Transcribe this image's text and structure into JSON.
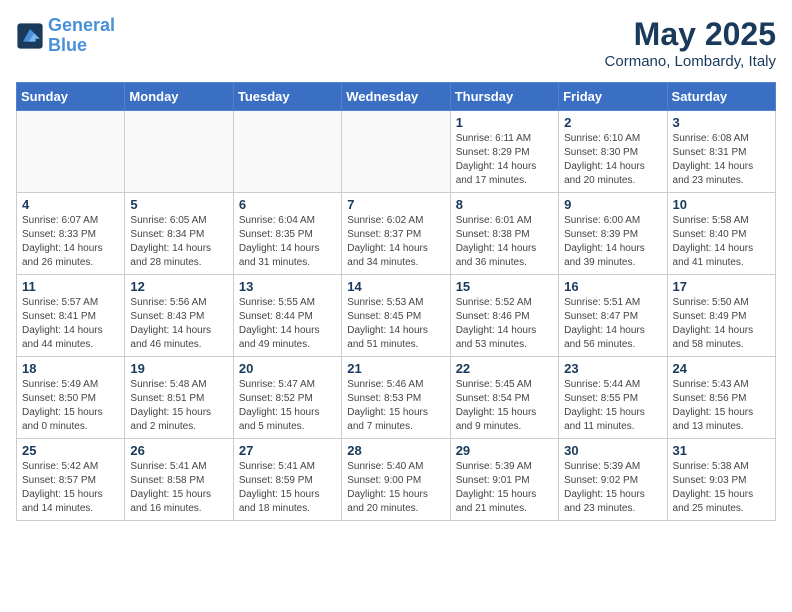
{
  "header": {
    "logo_line1": "General",
    "logo_line2": "Blue",
    "month": "May 2025",
    "location": "Cormano, Lombardy, Italy"
  },
  "weekdays": [
    "Sunday",
    "Monday",
    "Tuesday",
    "Wednesday",
    "Thursday",
    "Friday",
    "Saturday"
  ],
  "weeks": [
    [
      {
        "day": "",
        "info": ""
      },
      {
        "day": "",
        "info": ""
      },
      {
        "day": "",
        "info": ""
      },
      {
        "day": "",
        "info": ""
      },
      {
        "day": "1",
        "info": "Sunrise: 6:11 AM\nSunset: 8:29 PM\nDaylight: 14 hours\nand 17 minutes."
      },
      {
        "day": "2",
        "info": "Sunrise: 6:10 AM\nSunset: 8:30 PM\nDaylight: 14 hours\nand 20 minutes."
      },
      {
        "day": "3",
        "info": "Sunrise: 6:08 AM\nSunset: 8:31 PM\nDaylight: 14 hours\nand 23 minutes."
      }
    ],
    [
      {
        "day": "4",
        "info": "Sunrise: 6:07 AM\nSunset: 8:33 PM\nDaylight: 14 hours\nand 26 minutes."
      },
      {
        "day": "5",
        "info": "Sunrise: 6:05 AM\nSunset: 8:34 PM\nDaylight: 14 hours\nand 28 minutes."
      },
      {
        "day": "6",
        "info": "Sunrise: 6:04 AM\nSunset: 8:35 PM\nDaylight: 14 hours\nand 31 minutes."
      },
      {
        "day": "7",
        "info": "Sunrise: 6:02 AM\nSunset: 8:37 PM\nDaylight: 14 hours\nand 34 minutes."
      },
      {
        "day": "8",
        "info": "Sunrise: 6:01 AM\nSunset: 8:38 PM\nDaylight: 14 hours\nand 36 minutes."
      },
      {
        "day": "9",
        "info": "Sunrise: 6:00 AM\nSunset: 8:39 PM\nDaylight: 14 hours\nand 39 minutes."
      },
      {
        "day": "10",
        "info": "Sunrise: 5:58 AM\nSunset: 8:40 PM\nDaylight: 14 hours\nand 41 minutes."
      }
    ],
    [
      {
        "day": "11",
        "info": "Sunrise: 5:57 AM\nSunset: 8:41 PM\nDaylight: 14 hours\nand 44 minutes."
      },
      {
        "day": "12",
        "info": "Sunrise: 5:56 AM\nSunset: 8:43 PM\nDaylight: 14 hours\nand 46 minutes."
      },
      {
        "day": "13",
        "info": "Sunrise: 5:55 AM\nSunset: 8:44 PM\nDaylight: 14 hours\nand 49 minutes."
      },
      {
        "day": "14",
        "info": "Sunrise: 5:53 AM\nSunset: 8:45 PM\nDaylight: 14 hours\nand 51 minutes."
      },
      {
        "day": "15",
        "info": "Sunrise: 5:52 AM\nSunset: 8:46 PM\nDaylight: 14 hours\nand 53 minutes."
      },
      {
        "day": "16",
        "info": "Sunrise: 5:51 AM\nSunset: 8:47 PM\nDaylight: 14 hours\nand 56 minutes."
      },
      {
        "day": "17",
        "info": "Sunrise: 5:50 AM\nSunset: 8:49 PM\nDaylight: 14 hours\nand 58 minutes."
      }
    ],
    [
      {
        "day": "18",
        "info": "Sunrise: 5:49 AM\nSunset: 8:50 PM\nDaylight: 15 hours\nand 0 minutes."
      },
      {
        "day": "19",
        "info": "Sunrise: 5:48 AM\nSunset: 8:51 PM\nDaylight: 15 hours\nand 2 minutes."
      },
      {
        "day": "20",
        "info": "Sunrise: 5:47 AM\nSunset: 8:52 PM\nDaylight: 15 hours\nand 5 minutes."
      },
      {
        "day": "21",
        "info": "Sunrise: 5:46 AM\nSunset: 8:53 PM\nDaylight: 15 hours\nand 7 minutes."
      },
      {
        "day": "22",
        "info": "Sunrise: 5:45 AM\nSunset: 8:54 PM\nDaylight: 15 hours\nand 9 minutes."
      },
      {
        "day": "23",
        "info": "Sunrise: 5:44 AM\nSunset: 8:55 PM\nDaylight: 15 hours\nand 11 minutes."
      },
      {
        "day": "24",
        "info": "Sunrise: 5:43 AM\nSunset: 8:56 PM\nDaylight: 15 hours\nand 13 minutes."
      }
    ],
    [
      {
        "day": "25",
        "info": "Sunrise: 5:42 AM\nSunset: 8:57 PM\nDaylight: 15 hours\nand 14 minutes."
      },
      {
        "day": "26",
        "info": "Sunrise: 5:41 AM\nSunset: 8:58 PM\nDaylight: 15 hours\nand 16 minutes."
      },
      {
        "day": "27",
        "info": "Sunrise: 5:41 AM\nSunset: 8:59 PM\nDaylight: 15 hours\nand 18 minutes."
      },
      {
        "day": "28",
        "info": "Sunrise: 5:40 AM\nSunset: 9:00 PM\nDaylight: 15 hours\nand 20 minutes."
      },
      {
        "day": "29",
        "info": "Sunrise: 5:39 AM\nSunset: 9:01 PM\nDaylight: 15 hours\nand 21 minutes."
      },
      {
        "day": "30",
        "info": "Sunrise: 5:39 AM\nSunset: 9:02 PM\nDaylight: 15 hours\nand 23 minutes."
      },
      {
        "day": "31",
        "info": "Sunrise: 5:38 AM\nSunset: 9:03 PM\nDaylight: 15 hours\nand 25 minutes."
      }
    ]
  ]
}
